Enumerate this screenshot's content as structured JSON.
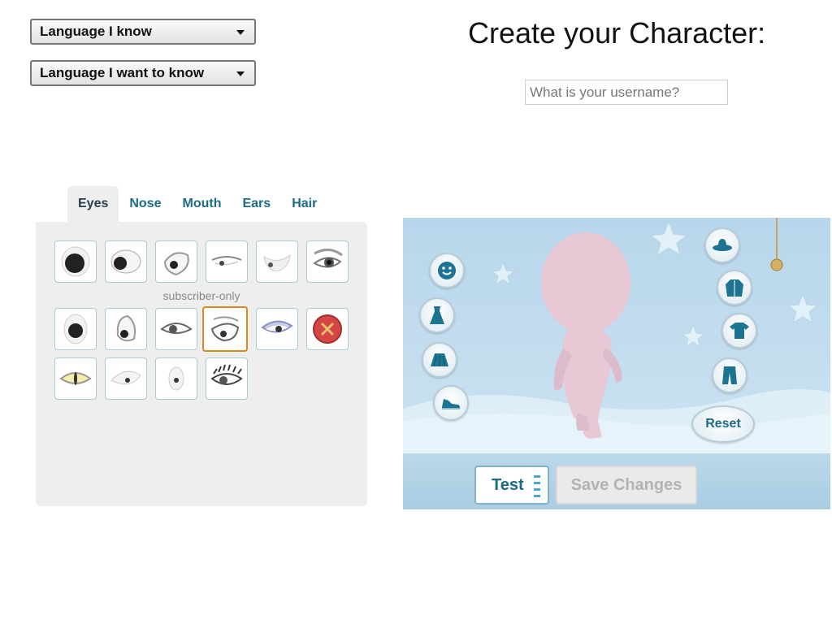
{
  "language": {
    "known_label": "Language I know",
    "want_label": "Language I want to know"
  },
  "header": {
    "title": "Create your Character:"
  },
  "username": {
    "placeholder": "What is your username?",
    "value": ""
  },
  "editor": {
    "tabs": [
      {
        "label": "Eyes",
        "active": true
      },
      {
        "label": "Nose",
        "active": false
      },
      {
        "label": "Mouth",
        "active": false
      },
      {
        "label": "Ears",
        "active": false
      },
      {
        "label": "Hair",
        "active": false
      }
    ],
    "subscriber_label": "subscriber-only",
    "selected_option": "eyes-option-10",
    "options": [
      "eyes-option-1",
      "eyes-option-2",
      "eyes-option-3",
      "eyes-option-4",
      "eyes-option-5",
      "eyes-option-6",
      "eyes-option-7",
      "eyes-option-8",
      "eyes-option-9",
      "eyes-option-10",
      "eyes-option-11",
      "eyes-option-12",
      "eyes-option-13",
      "eyes-option-14",
      "eyes-option-15",
      "eyes-option-16"
    ]
  },
  "scene": {
    "left_buttons": [
      "face-icon",
      "dress-icon",
      "skirt-icon",
      "shoe-icon"
    ],
    "right_buttons": [
      "hat-icon",
      "jacket-icon",
      "shirt-icon",
      "pants-icon"
    ],
    "reset_label": "Reset",
    "test_label": "Test",
    "save_label": "Save Changes"
  },
  "colors": {
    "accent": "#1a6c86",
    "selected_border": "#d58a1a",
    "scene_bg": "#c6dff0"
  }
}
